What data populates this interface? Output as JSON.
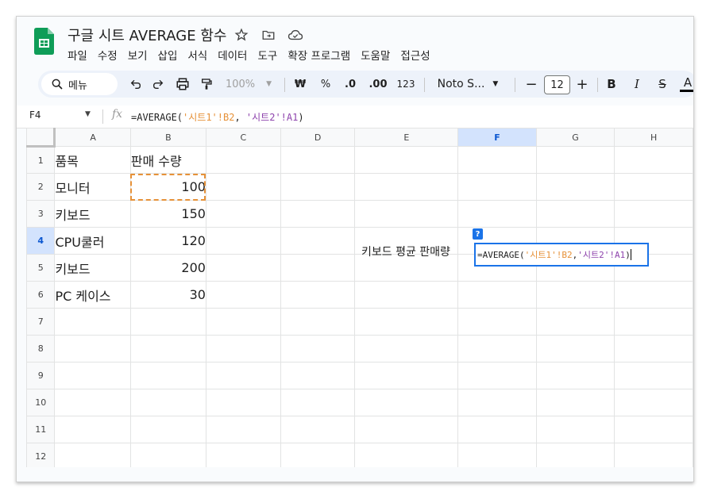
{
  "app": {
    "doc_title": "구글 시트 AVERAGE 함수",
    "menu": [
      "파일",
      "수정",
      "보기",
      "삽입",
      "서식",
      "데이터",
      "도구",
      "확장 프로그램",
      "도움말",
      "접근성"
    ]
  },
  "toolbar": {
    "search_label": "메뉴",
    "zoom": "100%",
    "currency": "₩",
    "percent": "%",
    "dec_decrease": ".0",
    "dec_increase": ".00",
    "number_format": "123",
    "font": "Noto S...",
    "font_size": "12",
    "minus": "−",
    "plus": "+",
    "bold": "B",
    "italic": "I",
    "strike": "S",
    "text_color": "A"
  },
  "formula_bar": {
    "name_box": "F4",
    "fx": "fx",
    "formula_prefix": "=AVERAGE(",
    "ref1": "'시트1'!B2",
    "sep": ", ",
    "ref2": "'시트2'!A1",
    "suffix": ")"
  },
  "grid": {
    "columns": [
      "A",
      "B",
      "C",
      "D",
      "E",
      "F",
      "G",
      "H"
    ],
    "rows": [
      "1",
      "2",
      "3",
      "4",
      "5",
      "6",
      "7",
      "8",
      "9",
      "10",
      "11",
      "12"
    ],
    "cells": {
      "A1": "품목",
      "B1": "판매 수량",
      "A2": "모니터",
      "B2": "100",
      "A3": "키보드",
      "B3": "150",
      "A4": "CPU쿨러",
      "B4": "120",
      "A5": "키보드",
      "B5": "200",
      "A6": "PC 케이스",
      "B6": "30",
      "E4": "키보드 평균 판매량"
    },
    "active_cell": "F4",
    "help_badge": "?"
  },
  "colors": {
    "ref1": "#e69138",
    "ref2": "#8e44ad",
    "selection": "#1a73e8",
    "toolbar_bg": "#edf2fa"
  }
}
